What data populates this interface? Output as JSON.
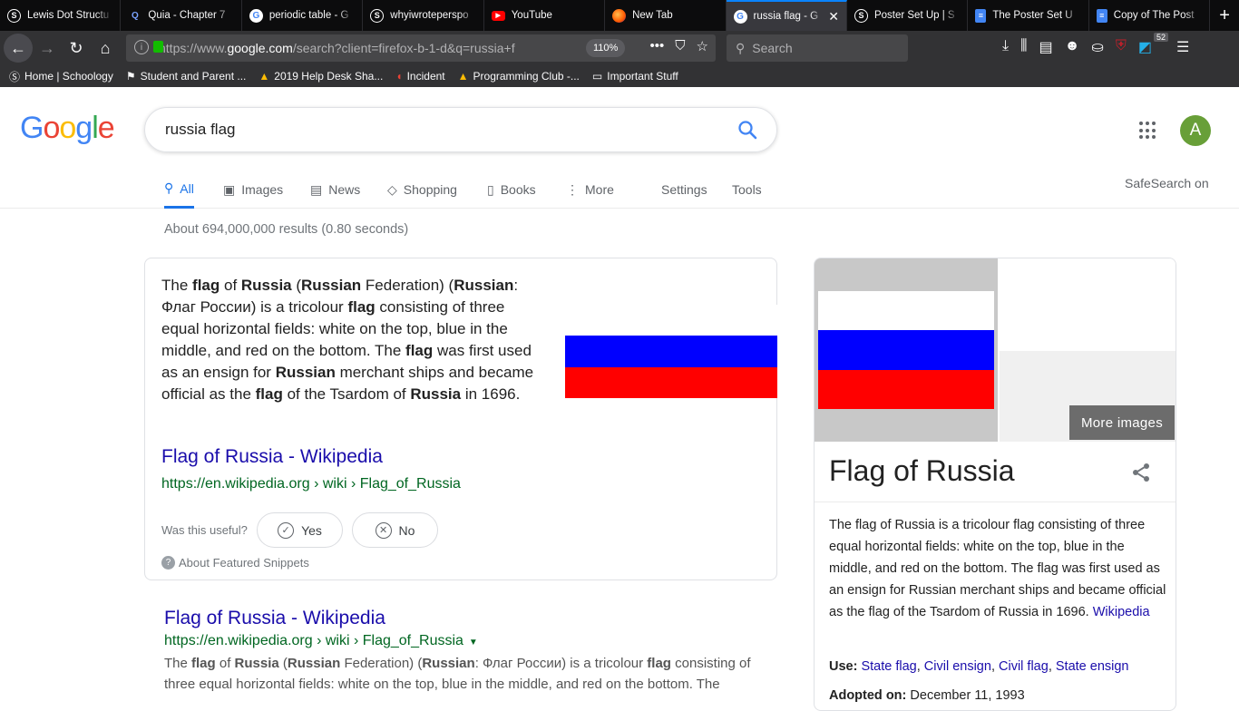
{
  "browser": {
    "tabs": [
      {
        "label": "Lewis Dot Structu",
        "icon": "schoology-icon"
      },
      {
        "label": "Quia - Chapter 7",
        "icon": "quia-icon"
      },
      {
        "label": "periodic table - G",
        "icon": "google-icon"
      },
      {
        "label": "whyiwroteperspo",
        "icon": "schoology-icon"
      },
      {
        "label": "YouTube",
        "icon": "youtube-icon"
      },
      {
        "label": "New Tab",
        "icon": "firefox-icon"
      },
      {
        "label": "russia flag - G",
        "icon": "google-icon",
        "active": true
      },
      {
        "label": "Poster Set Up | S",
        "icon": "schoology-icon"
      },
      {
        "label": "The Poster Set U",
        "icon": "docs-icon"
      },
      {
        "label": "Copy of The Post",
        "icon": "docs-icon"
      }
    ],
    "url_prefix": "https://www.",
    "url_domain": "google.com",
    "url_rest": "/search?client=firefox-b-1-d&q=russia+f",
    "zoom": "110%",
    "search_placeholder": "Search",
    "badge_count": "52",
    "bookmarks": [
      {
        "label": "Home | Schoology",
        "icon": "schoology-icon"
      },
      {
        "label": "Student and Parent ...",
        "icon": "flag-icon"
      },
      {
        "label": "2019 Help Desk Sha...",
        "icon": "drive-icon"
      },
      {
        "label": "Incident",
        "icon": "incident-icon"
      },
      {
        "label": "Programming Club -...",
        "icon": "drive-icon"
      },
      {
        "label": "Important Stuff",
        "icon": "folder-icon"
      }
    ]
  },
  "google": {
    "logo_letters": [
      "G",
      "o",
      "o",
      "g",
      "l",
      "e"
    ],
    "logo_colors": [
      "#4285f4",
      "#ea4335",
      "#fbbc05",
      "#4285f4",
      "#34a853",
      "#ea4335"
    ],
    "query": "russia flag",
    "avatar_letter": "A",
    "tabs": [
      {
        "label": "All",
        "icon": "search-icon",
        "active": true
      },
      {
        "label": "Images",
        "icon": "image-icon"
      },
      {
        "label": "News",
        "icon": "news-icon"
      },
      {
        "label": "Shopping",
        "icon": "tag-icon"
      },
      {
        "label": "Books",
        "icon": "book-icon"
      },
      {
        "label": "More",
        "icon": "kebab-icon"
      },
      {
        "label": "Settings"
      },
      {
        "label": "Tools"
      }
    ],
    "safesearch": "SafeSearch on",
    "stats": "About 694,000,000 results (0.80 seconds)"
  },
  "featured_snippet": {
    "text_html": "The <b>flag</b> of <b>Russia</b> (<b>Russian</b> Federation) (<b>Russian</b>: Флаг России) is a tricolour <b>flag</b> consisting of three equal horizontal fields: white on the top, blue in the middle, and red on the bottom. The <b>flag</b> was first used as an ensign for <b>Russian</b> merchant ships and became official as the <b>flag</b> of the Tsardom of <b>Russia</b> in 1696.",
    "link_title": "Flag of Russia - Wikipedia",
    "link_cite": "https://en.wikipedia.org › wiki › Flag_of_Russia",
    "useful_prompt": "Was this useful?",
    "yes_label": "Yes",
    "no_label": "No",
    "about_label": "About Featured Snippets",
    "flag_colors": [
      "#ffffff",
      "#0000ff",
      "#ff0000"
    ]
  },
  "result": {
    "title": "Flag of Russia - Wikipedia",
    "cite": "https://en.wikipedia.org › wiki › Flag_of_Russia",
    "desc_html": "The <b>flag</b> of <b>Russia</b> (<b>Russian</b> Federation) (<b>Russian</b>: Флаг России) is a tricolour <b>flag</b> consisting of three equal horizontal fields: white on the top, blue in the middle, and red on the bottom. The"
  },
  "knowledge_panel": {
    "more_images": "More images",
    "title": "Flag of Russia",
    "description": "The flag of Russia is a tricolour flag consisting of three equal horizontal fields: white on the top, blue in the middle, and red on the bottom. The flag was first used as an ensign for Russian merchant ships and became official as the flag of the Tsardom of Russia in 1696.",
    "source": "Wikipedia",
    "use_label": "Use:",
    "uses": [
      "State flag",
      "Civil ensign",
      "Civil flag",
      "State ensign"
    ],
    "adopted_label": "Adopted on:",
    "adopted_value": "December 11, 1993"
  }
}
